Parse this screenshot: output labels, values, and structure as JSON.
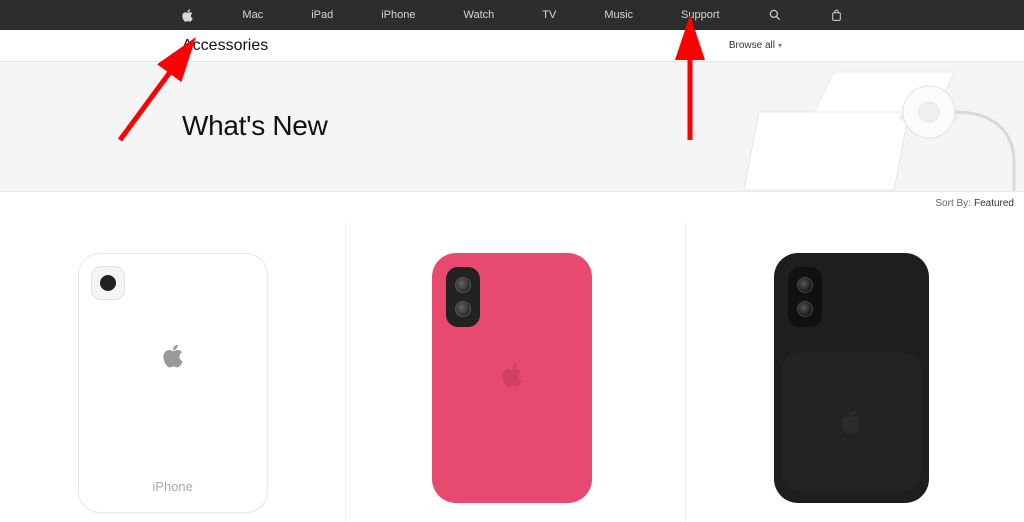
{
  "globalnav": {
    "items": [
      "Mac",
      "iPad",
      "iPhone",
      "Watch",
      "TV",
      "Music",
      "Support"
    ]
  },
  "subheader": {
    "title": "Accessories",
    "browse_all": "Browse all"
  },
  "hero": {
    "title": "What's New"
  },
  "sortbar": {
    "label": "Sort By:",
    "value": "Featured"
  },
  "products": [
    {
      "wordmark": "iPhone",
      "kind": "clear-case-white"
    },
    {
      "kind": "silicone-case-pink"
    },
    {
      "kind": "smart-battery-case-black"
    }
  ]
}
